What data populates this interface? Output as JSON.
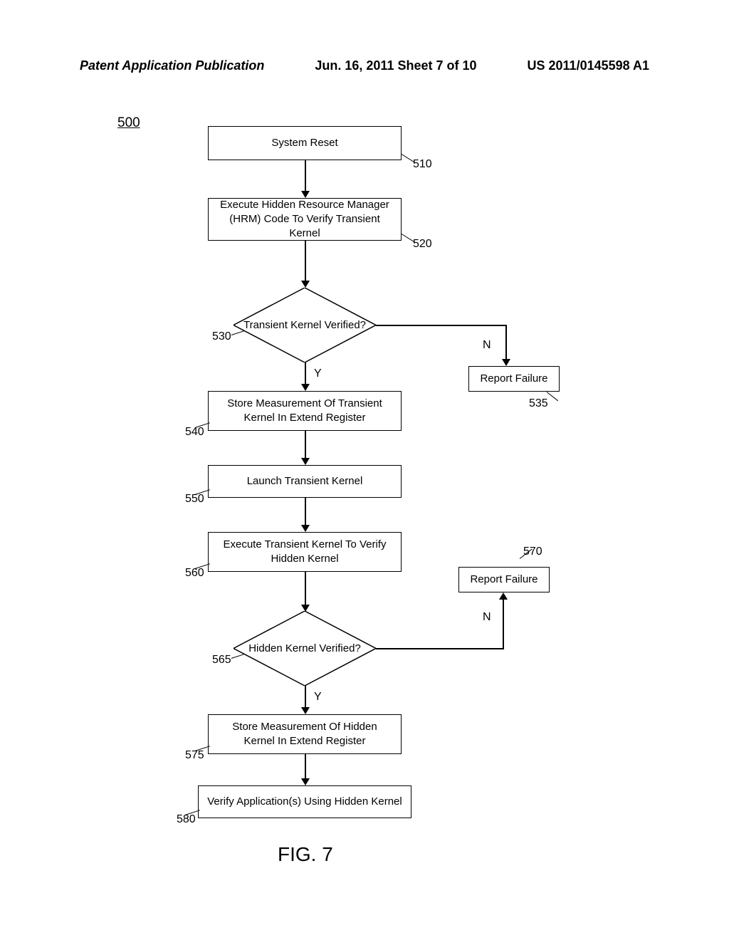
{
  "header": {
    "left": "Patent Application Publication",
    "mid": "Jun. 16, 2011  Sheet 7 of 10",
    "right": "US 2011/0145598 A1"
  },
  "figure_ref": "500",
  "figure_caption": "FIG. 7",
  "boxes": {
    "b510": "System Reset",
    "b520": "Execute Hidden Resource Manager (HRM) Code To Verify Transient Kernel",
    "d530": "Transient Kernel Verified?",
    "b535": "Report Failure",
    "b540": "Store Measurement Of Transient Kernel In Extend Register",
    "b550": "Launch Transient Kernel",
    "b560": "Execute Transient Kernel To Verify Hidden Kernel",
    "d565": "Hidden Kernel Verified?",
    "b570": "Report Failure",
    "b575": "Store Measurement Of Hidden Kernel In Extend Register",
    "b580": "Verify Application(s) Using Hidden Kernel"
  },
  "labels": {
    "yes": "Y",
    "no": "N"
  },
  "refs": {
    "r510": "510",
    "r520": "520",
    "r530": "530",
    "r535": "535",
    "r540": "540",
    "r550": "550",
    "r560": "560",
    "r565": "565",
    "r570": "570",
    "r575": "575",
    "r580": "580"
  }
}
